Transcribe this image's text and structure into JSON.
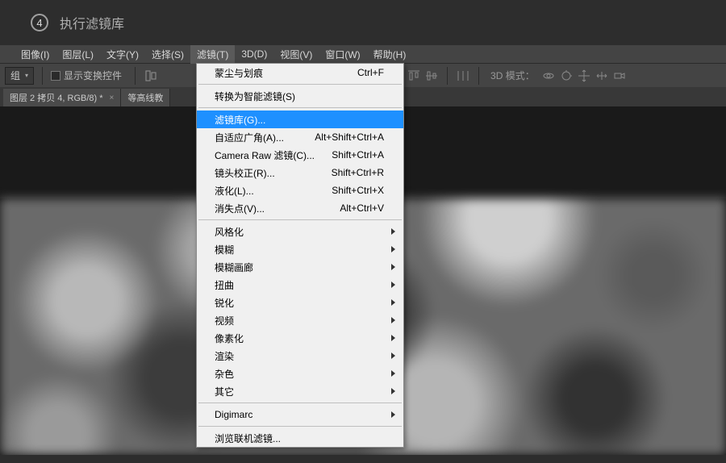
{
  "title_bar": {
    "step_number": "4",
    "text": "执行滤镜库"
  },
  "menu_bar": {
    "items": [
      "图像(I)",
      "图层(L)",
      "文字(Y)",
      "选择(S)",
      "滤镜(T)",
      "3D(D)",
      "视图(V)",
      "窗口(W)",
      "帮助(H)"
    ],
    "active_index": 4
  },
  "options_bar": {
    "group_label": "组",
    "show_transform_label": "显示变换控件",
    "mode_3d_label": "3D 模式："
  },
  "tabs": [
    {
      "label": "图层 2 拷贝 4, RGB/8) *",
      "closable": true
    },
    {
      "label": "等高线教",
      "closable": false
    }
  ],
  "filter_menu": {
    "rows": [
      {
        "type": "item",
        "label": "蒙尘与划痕",
        "shortcut": "Ctrl+F"
      },
      {
        "type": "sep"
      },
      {
        "type": "item",
        "label": "转换为智能滤镜(S)"
      },
      {
        "type": "sep"
      },
      {
        "type": "item",
        "label": "滤镜库(G)...",
        "selected": true
      },
      {
        "type": "item",
        "label": "自适应广角(A)...",
        "shortcut": "Alt+Shift+Ctrl+A"
      },
      {
        "type": "item",
        "label": "Camera Raw 滤镜(C)...",
        "shortcut": "Shift+Ctrl+A"
      },
      {
        "type": "item",
        "label": "镜头校正(R)...",
        "shortcut": "Shift+Ctrl+R"
      },
      {
        "type": "item",
        "label": "液化(L)...",
        "shortcut": "Shift+Ctrl+X"
      },
      {
        "type": "item",
        "label": "消失点(V)...",
        "shortcut": "Alt+Ctrl+V"
      },
      {
        "type": "sep"
      },
      {
        "type": "item",
        "label": "风格化",
        "submenu": true
      },
      {
        "type": "item",
        "label": "模糊",
        "submenu": true
      },
      {
        "type": "item",
        "label": "模糊画廊",
        "submenu": true
      },
      {
        "type": "item",
        "label": "扭曲",
        "submenu": true
      },
      {
        "type": "item",
        "label": "锐化",
        "submenu": true
      },
      {
        "type": "item",
        "label": "视频",
        "submenu": true
      },
      {
        "type": "item",
        "label": "像素化",
        "submenu": true
      },
      {
        "type": "item",
        "label": "渲染",
        "submenu": true
      },
      {
        "type": "item",
        "label": "杂色",
        "submenu": true
      },
      {
        "type": "item",
        "label": "其它",
        "submenu": true
      },
      {
        "type": "sep"
      },
      {
        "type": "item",
        "label": "Digimarc",
        "submenu": true
      },
      {
        "type": "sep"
      },
      {
        "type": "item",
        "label": "浏览联机滤镜..."
      }
    ]
  }
}
